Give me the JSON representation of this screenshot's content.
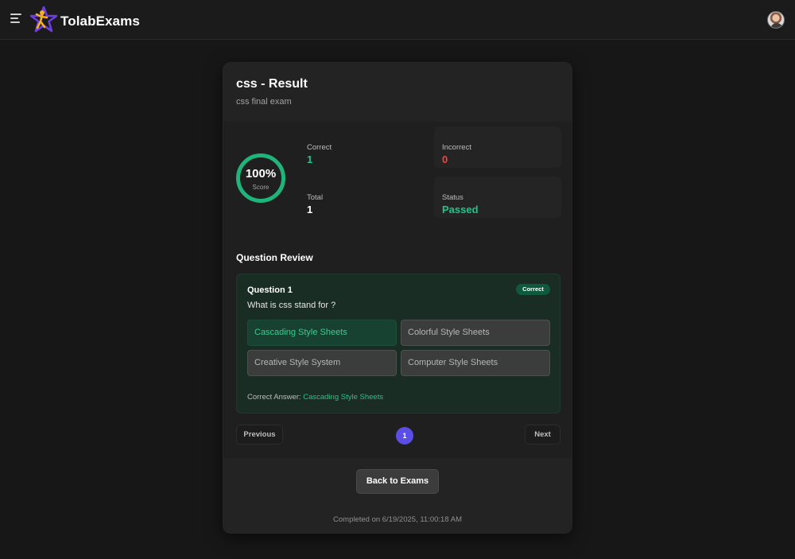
{
  "app": {
    "brand": "TolabExams"
  },
  "result": {
    "title": "css - Result",
    "subtitle": "css final exam",
    "score_percent": 100,
    "score_text": "100%",
    "score_label": "Score",
    "stats": {
      "correct": {
        "label": "Correct",
        "value": "1"
      },
      "incorrect": {
        "label": "Incorrect",
        "value": "0"
      },
      "total": {
        "label": "Total",
        "value": "1"
      },
      "status": {
        "label": "Status",
        "value": "Passed"
      }
    }
  },
  "review": {
    "section_title": "Question Review",
    "question": {
      "number_label": "Question 1",
      "badge": "Correct",
      "text": "What is css stand for ?",
      "options": [
        "Cascading Style Sheets",
        "Colorful Style Sheets",
        "Creative Style System",
        "Computer Style Sheets"
      ],
      "selected_index": 0,
      "correct_answer_label": "Correct Answer:",
      "correct_answer": "Cascading Style Sheets"
    }
  },
  "pagination": {
    "previous": "Previous",
    "current": "1",
    "next": "Next"
  },
  "footer": {
    "back_button": "Back to Exams",
    "completed": "Completed on 6/19/2025, 11:00:18 AM"
  },
  "colors": {
    "correct": "#22c38a",
    "incorrect": "#ef4444",
    "accent": "#5b4ee6",
    "ring": "#1db57a"
  },
  "icons": {
    "menu": "menu-icon",
    "logo": "star-person-logo-icon",
    "avatar": "user-avatar"
  }
}
